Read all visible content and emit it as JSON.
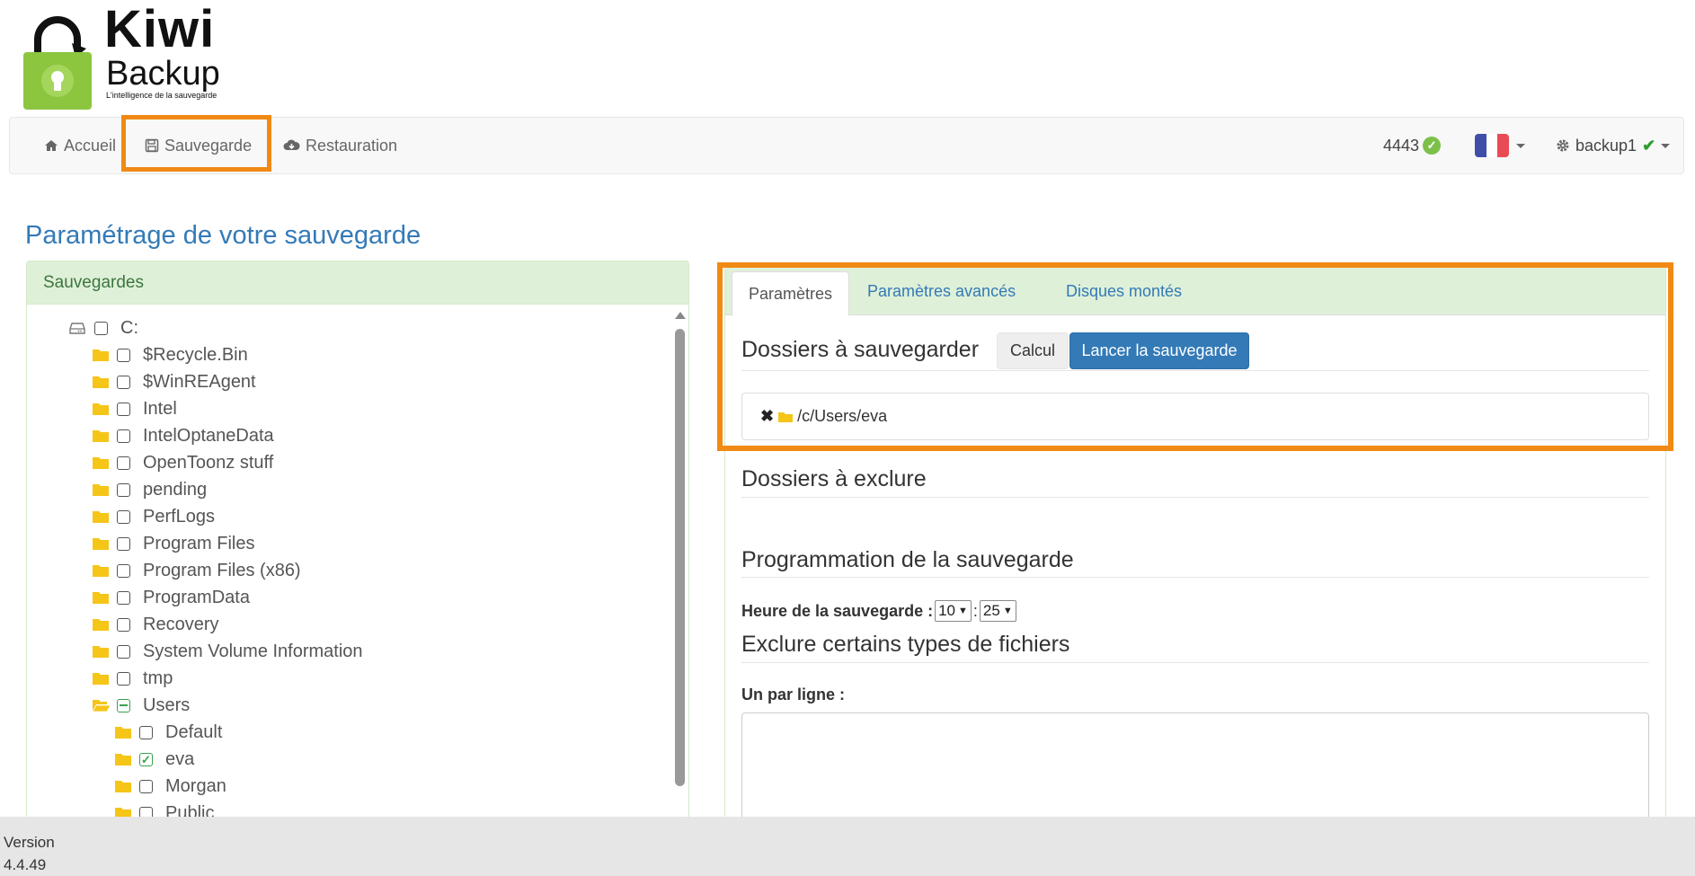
{
  "logo": {
    "name_line1": "Kiwi",
    "name_line2": "Backup",
    "tagline": "L'intelligence de la sauvegarde"
  },
  "navbar": {
    "items": [
      {
        "label": "Accueil",
        "icon": "home-icon"
      },
      {
        "label": "Sauvegarde",
        "icon": "floppy-disk-icon"
      },
      {
        "label": "Restauration",
        "icon": "cloud-download-icon"
      }
    ],
    "count": "4443",
    "language": "fr",
    "user": "backup1",
    "colors": {
      "highlight": "#f08a14",
      "ok": "#7cc04a"
    }
  },
  "page": {
    "title": "Paramétrage de votre sauvegarde"
  },
  "left_panel": {
    "heading": "Sauvegardes",
    "tree": [
      {
        "label": "C:",
        "type": "drive",
        "state": "unchecked",
        "level": 0
      },
      {
        "label": "$Recycle.Bin",
        "type": "folder",
        "state": "unchecked",
        "level": 1
      },
      {
        "label": "$WinREAgent",
        "type": "folder",
        "state": "unchecked",
        "level": 1
      },
      {
        "label": "Intel",
        "type": "folder",
        "state": "unchecked",
        "level": 1
      },
      {
        "label": "IntelOptaneData",
        "type": "folder",
        "state": "unchecked",
        "level": 1
      },
      {
        "label": "OpenToonz stuff",
        "type": "folder",
        "state": "unchecked",
        "level": 1
      },
      {
        "label": "pending",
        "type": "folder",
        "state": "unchecked",
        "level": 1
      },
      {
        "label": "PerfLogs",
        "type": "folder",
        "state": "unchecked",
        "level": 1
      },
      {
        "label": "Program Files",
        "type": "folder",
        "state": "unchecked",
        "level": 1
      },
      {
        "label": "Program Files (x86)",
        "type": "folder",
        "state": "unchecked",
        "level": 1
      },
      {
        "label": "ProgramData",
        "type": "folder",
        "state": "unchecked",
        "level": 1
      },
      {
        "label": "Recovery",
        "type": "folder",
        "state": "unchecked",
        "level": 1
      },
      {
        "label": "System Volume Information",
        "type": "folder",
        "state": "unchecked",
        "level": 1
      },
      {
        "label": "tmp",
        "type": "folder",
        "state": "unchecked",
        "level": 1
      },
      {
        "label": "Users",
        "type": "folder-open",
        "state": "partial",
        "level": 1
      },
      {
        "label": "Default",
        "type": "folder",
        "state": "unchecked",
        "level": 2
      },
      {
        "label": "eva",
        "type": "folder",
        "state": "checked",
        "level": 2
      },
      {
        "label": "Morgan",
        "type": "folder",
        "state": "unchecked",
        "level": 2
      },
      {
        "label": "Public",
        "type": "folder",
        "state": "unchecked",
        "level": 2
      }
    ]
  },
  "right_panel": {
    "tabs": [
      {
        "label": "Paramètres",
        "active": true
      },
      {
        "label": "Paramètres avancés",
        "active": false
      },
      {
        "label": "Disques montés",
        "active": false
      }
    ],
    "backup_folders": {
      "title": "Dossiers à sauvegarder",
      "calc_button": "Calcul",
      "launch_button": "Lancer la sauvegarde",
      "paths": [
        "/c/Users/eva"
      ]
    },
    "exclude_folders": {
      "title": "Dossiers à exclure"
    },
    "schedule": {
      "title": "Programmation de la sauvegarde",
      "time_label": "Heure de la sauvegarde :",
      "separator": ":",
      "hour": "10",
      "minute": "25"
    },
    "exclude_types": {
      "title": "Exclure certains types de fichiers",
      "per_line_label": "Un par ligne :"
    }
  },
  "footer": {
    "version_label": "Version",
    "version": "4.4.49"
  }
}
